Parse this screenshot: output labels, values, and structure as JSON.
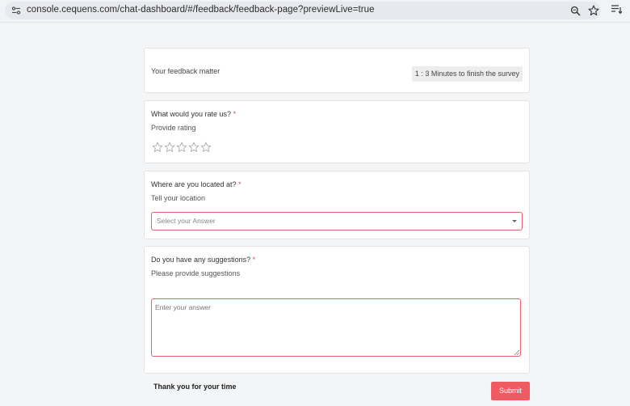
{
  "browser": {
    "url": "console.cequens.com/chat-dashboard/#/feedback/feedback-page?previewLive=true"
  },
  "intro": {
    "title": "Your feedback matter",
    "timer": "1 : 3 Minutes to finish the survey"
  },
  "questions": [
    {
      "title": "What would you rate us?",
      "required_mark": "*",
      "subtitle": "Provide rating",
      "rating_max": 5,
      "rating_value": 0
    },
    {
      "title": "Where are you located at?",
      "required_mark": "*",
      "subtitle": "Tell your location",
      "placeholder": "Select your Answer"
    },
    {
      "title": "Do you have any suggestions?",
      "required_mark": "*",
      "subtitle": "Please provide suggestions",
      "placeholder": "Enter your answer"
    }
  ],
  "footer": {
    "thanks": "Thank you for your time",
    "submit_label": "Submit"
  },
  "colors": {
    "accent": "#ef5a63",
    "required": "#e24a53",
    "page_background": "#f4f5f7"
  }
}
